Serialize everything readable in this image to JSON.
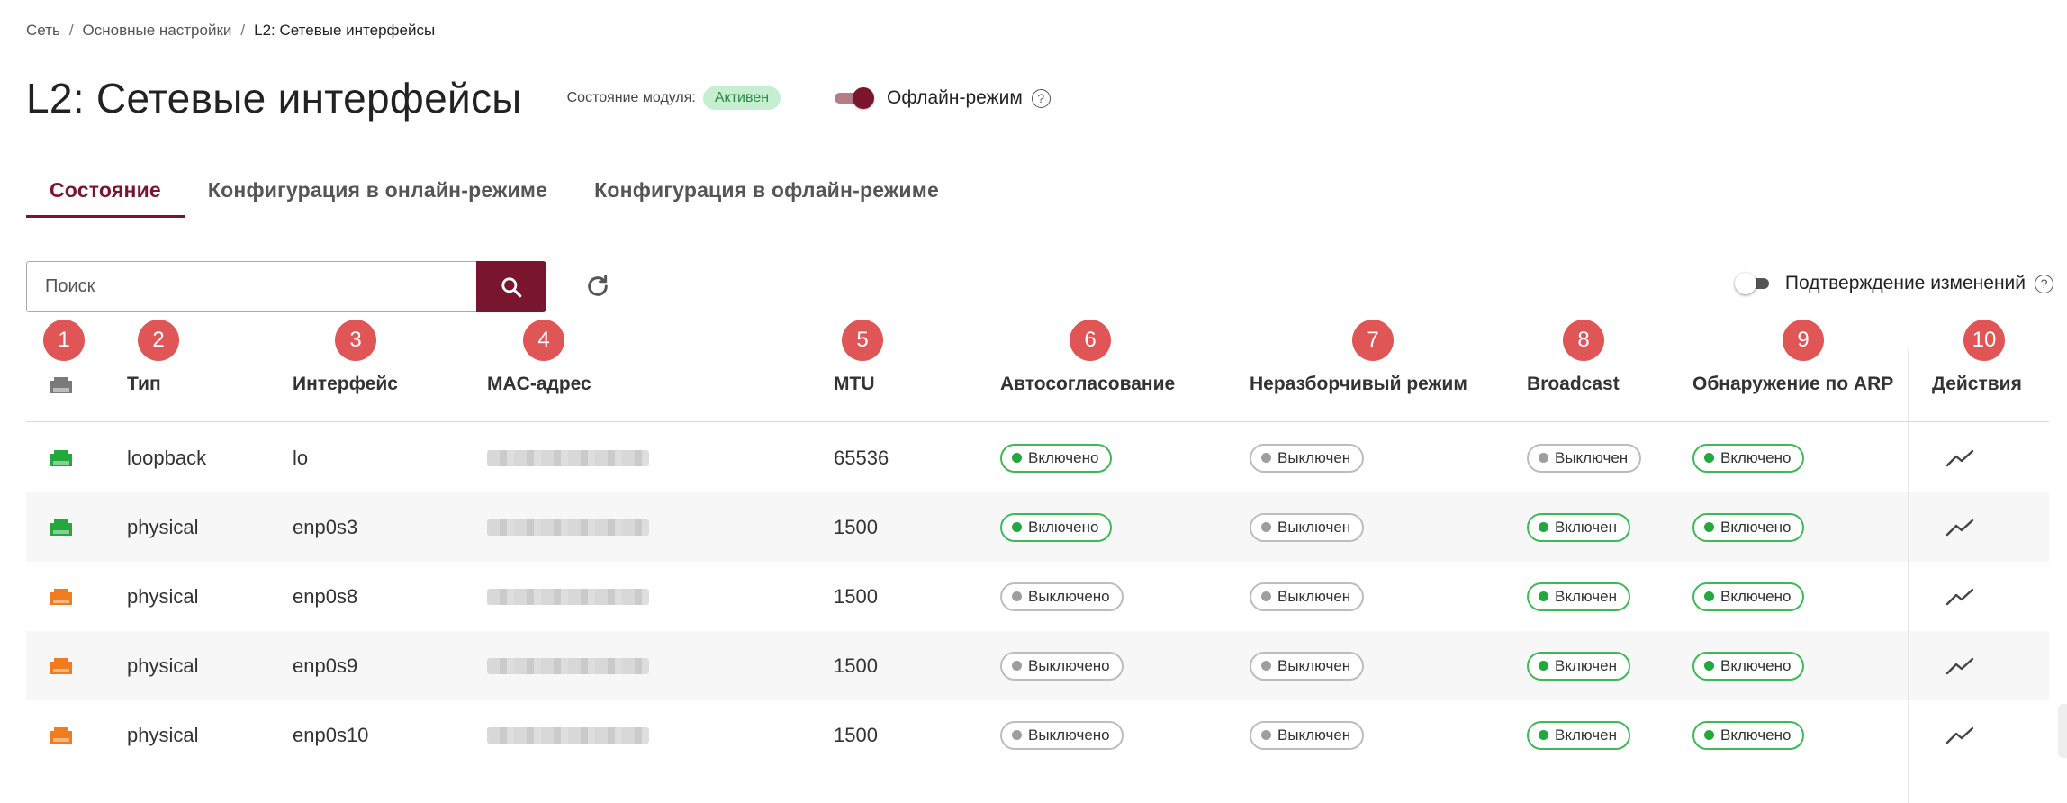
{
  "breadcrumb": {
    "items": [
      "Сеть",
      "Основные настройки"
    ],
    "current": "L2: Сетевые интерфейсы",
    "separator": "/"
  },
  "header": {
    "title": "L2: Сетевые интерфейсы",
    "module_state_label": "Состояние модуля:",
    "module_state_value": "Активен",
    "offline_mode_label": "Офлайн-режим",
    "help_glyph": "?"
  },
  "tabs": [
    {
      "label": "Состояние",
      "active": true
    },
    {
      "label": "Конфигурация в онлайн-режиме",
      "active": false
    },
    {
      "label": "Конфигурация в офлайн-режиме",
      "active": false
    }
  ],
  "search": {
    "placeholder": "Поиск",
    "value": ""
  },
  "confirm_changes": {
    "label": "Подтверждение изменений",
    "help_glyph": "?"
  },
  "markers": [
    "1",
    "2",
    "3",
    "4",
    "5",
    "6",
    "7",
    "8",
    "9",
    "10"
  ],
  "columns": {
    "type": "Тип",
    "interface": "Интерфейс",
    "mac": "MAC-адрес",
    "mtu": "MTU",
    "autoneg": "Автосогласование",
    "promisc": "Неразборчивый режим",
    "broadcast": "Broadcast",
    "arp": "Обнаружение по ARP",
    "actions": "Действия"
  },
  "rows": [
    {
      "status": "green",
      "type": "loopback",
      "interface": "lo",
      "mtu": "65536",
      "autoneg": "Включено",
      "promisc": "Выключен",
      "broadcast": "Выключен",
      "arp": "Включено"
    },
    {
      "status": "green",
      "type": "physical",
      "interface": "enp0s3",
      "mtu": "1500",
      "autoneg": "Включено",
      "promisc": "Выключен",
      "broadcast": "Включен",
      "arp": "Включено"
    },
    {
      "status": "orange",
      "type": "physical",
      "interface": "enp0s8",
      "mtu": "1500",
      "autoneg": "Выключено",
      "promisc": "Выключен",
      "broadcast": "Включен",
      "arp": "Включено"
    },
    {
      "status": "orange",
      "type": "physical",
      "interface": "enp0s9",
      "mtu": "1500",
      "autoneg": "Выключено",
      "promisc": "Выключен",
      "broadcast": "Включен",
      "arp": "Включено"
    },
    {
      "status": "orange",
      "type": "physical",
      "interface": "enp0s10",
      "mtu": "1500",
      "autoneg": "Выключено",
      "promisc": "Выключен",
      "broadcast": "Включен",
      "arp": "Включено"
    }
  ],
  "colors": {
    "accent": "#7a1530",
    "status_green": "#22a83c",
    "status_orange": "#f07c1f",
    "status_header": "#7a7a7a",
    "marker": "#e05555"
  },
  "icons": {
    "status": "network-port-icon",
    "search": "search-icon",
    "refresh": "refresh-icon",
    "action": "trend-chart-icon",
    "help": "help-circle-icon"
  }
}
